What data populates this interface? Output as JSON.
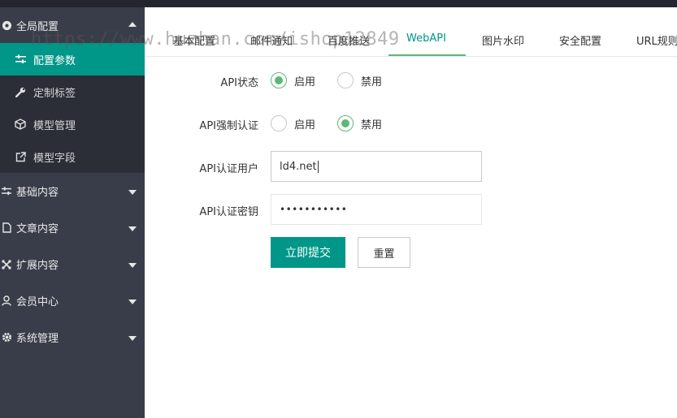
{
  "sidebar": {
    "groups": [
      {
        "label": "全局配置",
        "icon": "settings-circle-icon",
        "expanded": true,
        "items": [
          {
            "label": "配置参数",
            "icon": "sliders-icon",
            "active": true
          },
          {
            "label": "定制标签",
            "icon": "wrench-icon",
            "active": false
          },
          {
            "label": "模型管理",
            "icon": "cube-icon",
            "active": false
          },
          {
            "label": "模型字段",
            "icon": "external-link-icon",
            "active": false
          }
        ]
      },
      {
        "label": "基础内容",
        "icon": "sliders-icon",
        "expanded": false
      },
      {
        "label": "文章内容",
        "icon": "document-icon",
        "expanded": false
      },
      {
        "label": "扩展内容",
        "icon": "expand-icon",
        "expanded": false
      },
      {
        "label": "会员中心",
        "icon": "user-icon",
        "expanded": false
      },
      {
        "label": "系统管理",
        "icon": "gear-icon",
        "expanded": false
      }
    ]
  },
  "tabs": [
    {
      "label": "基本配置",
      "active": false
    },
    {
      "label": "邮件通知",
      "active": false
    },
    {
      "label": "百度推送",
      "active": false
    },
    {
      "label": "WebAPI",
      "active": true
    },
    {
      "label": "图片水印",
      "active": false
    },
    {
      "label": "安全配置",
      "active": false
    },
    {
      "label": "URL规则",
      "active": false
    }
  ],
  "form": {
    "api_status": {
      "label": "API状态",
      "options": [
        "启用",
        "禁用"
      ],
      "selected": "启用"
    },
    "api_auth": {
      "label": "API强制认证",
      "options": [
        "启用",
        "禁用"
      ],
      "selected": "禁用"
    },
    "api_user": {
      "label": "API认证用户",
      "value": "ld4.net"
    },
    "api_secret": {
      "label": "API认证密钥",
      "value": "•••••••••••"
    },
    "submit_label": "立即提交",
    "reset_label": "重置"
  },
  "watermark": "https://www.huzhan.com/ishop12849",
  "colors": {
    "accent": "#009688",
    "radio": "#5FB878",
    "sidebar": "#393d49",
    "sidebar_sub": "#2b2e37"
  }
}
